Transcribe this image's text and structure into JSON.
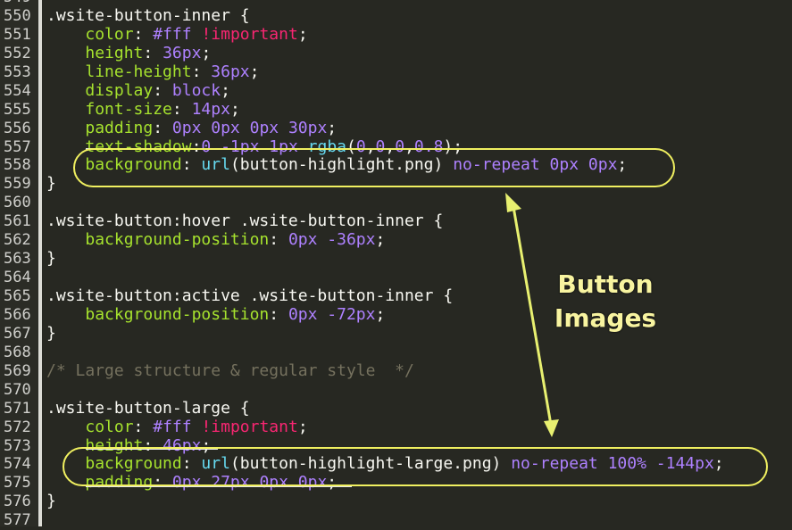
{
  "gutter": {
    "top_partial": "549"
  },
  "lines": [
    {
      "num": "550",
      "parts": [
        {
          "c": "k-sel",
          "t": ".wsite-button-inner {"
        }
      ]
    },
    {
      "num": "551",
      "parts": [
        {
          "c": "k-sel",
          "t": "    "
        },
        {
          "c": "k-prop",
          "t": "color"
        },
        {
          "c": "k-sel",
          "t": ": "
        },
        {
          "c": "k-val",
          "t": "#fff"
        },
        {
          "c": "k-sel",
          "t": " "
        },
        {
          "c": "k-imp",
          "t": "!important"
        },
        {
          "c": "k-sel",
          "t": ";"
        }
      ]
    },
    {
      "num": "552",
      "parts": [
        {
          "c": "k-sel",
          "t": "    "
        },
        {
          "c": "k-prop",
          "t": "height"
        },
        {
          "c": "k-sel",
          "t": ": "
        },
        {
          "c": "k-val",
          "t": "36px"
        },
        {
          "c": "k-sel",
          "t": ";"
        }
      ]
    },
    {
      "num": "553",
      "parts": [
        {
          "c": "k-sel",
          "t": "    "
        },
        {
          "c": "k-prop",
          "t": "line-height"
        },
        {
          "c": "k-sel",
          "t": ": "
        },
        {
          "c": "k-val",
          "t": "36px"
        },
        {
          "c": "k-sel",
          "t": ";"
        }
      ]
    },
    {
      "num": "554",
      "parts": [
        {
          "c": "k-sel",
          "t": "    "
        },
        {
          "c": "k-prop",
          "t": "display"
        },
        {
          "c": "k-sel",
          "t": ": "
        },
        {
          "c": "k-val",
          "t": "block"
        },
        {
          "c": "k-sel",
          "t": ";"
        }
      ]
    },
    {
      "num": "555",
      "parts": [
        {
          "c": "k-sel",
          "t": "    "
        },
        {
          "c": "k-prop",
          "t": "font-size"
        },
        {
          "c": "k-sel",
          "t": ": "
        },
        {
          "c": "k-val",
          "t": "14px"
        },
        {
          "c": "k-sel",
          "t": ";"
        }
      ]
    },
    {
      "num": "556",
      "parts": [
        {
          "c": "k-sel",
          "t": "    "
        },
        {
          "c": "k-prop",
          "t": "padding"
        },
        {
          "c": "k-sel",
          "t": ": "
        },
        {
          "c": "k-val",
          "t": "0px 0px 0px 30px"
        },
        {
          "c": "k-sel",
          "t": ";"
        }
      ]
    },
    {
      "num": "557",
      "parts": [
        {
          "c": "k-sel",
          "t": "    "
        },
        {
          "c": "k-prop",
          "t": "text-shadow"
        },
        {
          "c": "k-sel",
          "t": ":"
        },
        {
          "c": "k-val",
          "t": "0 -1px 1px "
        },
        {
          "c": "k-url",
          "t": "rgba"
        },
        {
          "c": "k-sel",
          "t": "("
        },
        {
          "c": "k-val",
          "t": "0"
        },
        {
          "c": "k-sel",
          "t": ","
        },
        {
          "c": "k-val",
          "t": "0"
        },
        {
          "c": "k-sel",
          "t": ","
        },
        {
          "c": "k-val",
          "t": "0"
        },
        {
          "c": "k-sel",
          "t": ","
        },
        {
          "c": "k-val",
          "t": "0.8"
        },
        {
          "c": "k-sel",
          "t": ");"
        }
      ]
    },
    {
      "num": "558",
      "parts": [
        {
          "c": "k-sel",
          "t": "    "
        },
        {
          "c": "k-prop",
          "t": "background"
        },
        {
          "c": "k-sel",
          "t": ": "
        },
        {
          "c": "k-url",
          "t": "url"
        },
        {
          "c": "k-sel",
          "t": "(button-highlight.png) "
        },
        {
          "c": "k-val",
          "t": "no-repeat 0px 0px"
        },
        {
          "c": "k-sel",
          "t": ";"
        }
      ]
    },
    {
      "num": "559",
      "parts": [
        {
          "c": "k-sel",
          "t": "}"
        }
      ]
    },
    {
      "num": "560",
      "parts": []
    },
    {
      "num": "561",
      "parts": [
        {
          "c": "k-sel",
          "t": ".wsite-button:hover .wsite-button-inner {"
        }
      ]
    },
    {
      "num": "562",
      "parts": [
        {
          "c": "k-sel",
          "t": "    "
        },
        {
          "c": "k-prop",
          "t": "background-position"
        },
        {
          "c": "k-sel",
          "t": ": "
        },
        {
          "c": "k-val",
          "t": "0px -36px"
        },
        {
          "c": "k-sel",
          "t": ";"
        }
      ]
    },
    {
      "num": "563",
      "parts": [
        {
          "c": "k-sel",
          "t": "}"
        }
      ]
    },
    {
      "num": "564",
      "parts": []
    },
    {
      "num": "565",
      "parts": [
        {
          "c": "k-sel",
          "t": ".wsite-button:active .wsite-button-inner {"
        }
      ]
    },
    {
      "num": "566",
      "parts": [
        {
          "c": "k-sel",
          "t": "    "
        },
        {
          "c": "k-prop",
          "t": "background-position"
        },
        {
          "c": "k-sel",
          "t": ": "
        },
        {
          "c": "k-val",
          "t": "0px -72px"
        },
        {
          "c": "k-sel",
          "t": ";"
        }
      ]
    },
    {
      "num": "567",
      "parts": [
        {
          "c": "k-sel",
          "t": "}"
        }
      ]
    },
    {
      "num": "568",
      "parts": []
    },
    {
      "num": "569",
      "parts": [
        {
          "c": "k-com",
          "t": "/* Large structure & regular style  */"
        }
      ]
    },
    {
      "num": "570",
      "parts": []
    },
    {
      "num": "571",
      "parts": [
        {
          "c": "k-sel",
          "t": ".wsite-button-large {"
        }
      ]
    },
    {
      "num": "572",
      "parts": [
        {
          "c": "k-sel",
          "t": "    "
        },
        {
          "c": "k-prop",
          "t": "color"
        },
        {
          "c": "k-sel",
          "t": ": "
        },
        {
          "c": "k-val",
          "t": "#fff"
        },
        {
          "c": "k-sel",
          "t": " "
        },
        {
          "c": "k-imp",
          "t": "!important"
        },
        {
          "c": "k-sel",
          "t": ";"
        }
      ]
    },
    {
      "num": "573",
      "parts": [
        {
          "c": "k-sel",
          "t": "    "
        },
        {
          "c": "k-prop",
          "t": "height"
        },
        {
          "c": "k-sel",
          "t": ": "
        },
        {
          "c": "k-val",
          "t": "46px"
        },
        {
          "c": "k-sel",
          "t": ";"
        }
      ]
    },
    {
      "num": "574",
      "parts": [
        {
          "c": "k-sel",
          "t": "    "
        },
        {
          "c": "k-prop",
          "t": "background"
        },
        {
          "c": "k-sel",
          "t": ": "
        },
        {
          "c": "k-url",
          "t": "url"
        },
        {
          "c": "k-sel",
          "t": "(button-highlight-large.png) "
        },
        {
          "c": "k-val",
          "t": "no-repeat 100% -144px"
        },
        {
          "c": "k-sel",
          "t": ";"
        }
      ]
    },
    {
      "num": "575",
      "parts": [
        {
          "c": "k-sel",
          "t": "    "
        },
        {
          "c": "k-prop",
          "t": "padding"
        },
        {
          "c": "k-sel",
          "t": ": "
        },
        {
          "c": "k-val",
          "t": "0px 27px 0px 0px"
        },
        {
          "c": "k-sel",
          "t": ";"
        }
      ]
    },
    {
      "num": "576",
      "parts": [
        {
          "c": "k-sel",
          "t": "}"
        }
      ]
    },
    {
      "num": "577",
      "parts": []
    }
  ],
  "annotation": {
    "line1": "Button",
    "line2": "Images",
    "color": "#f0f060"
  },
  "theme": {
    "background": "#272822",
    "property": "#a6e22e",
    "value": "#ae81ff",
    "important": "#f92672",
    "comment": "#75715e"
  }
}
